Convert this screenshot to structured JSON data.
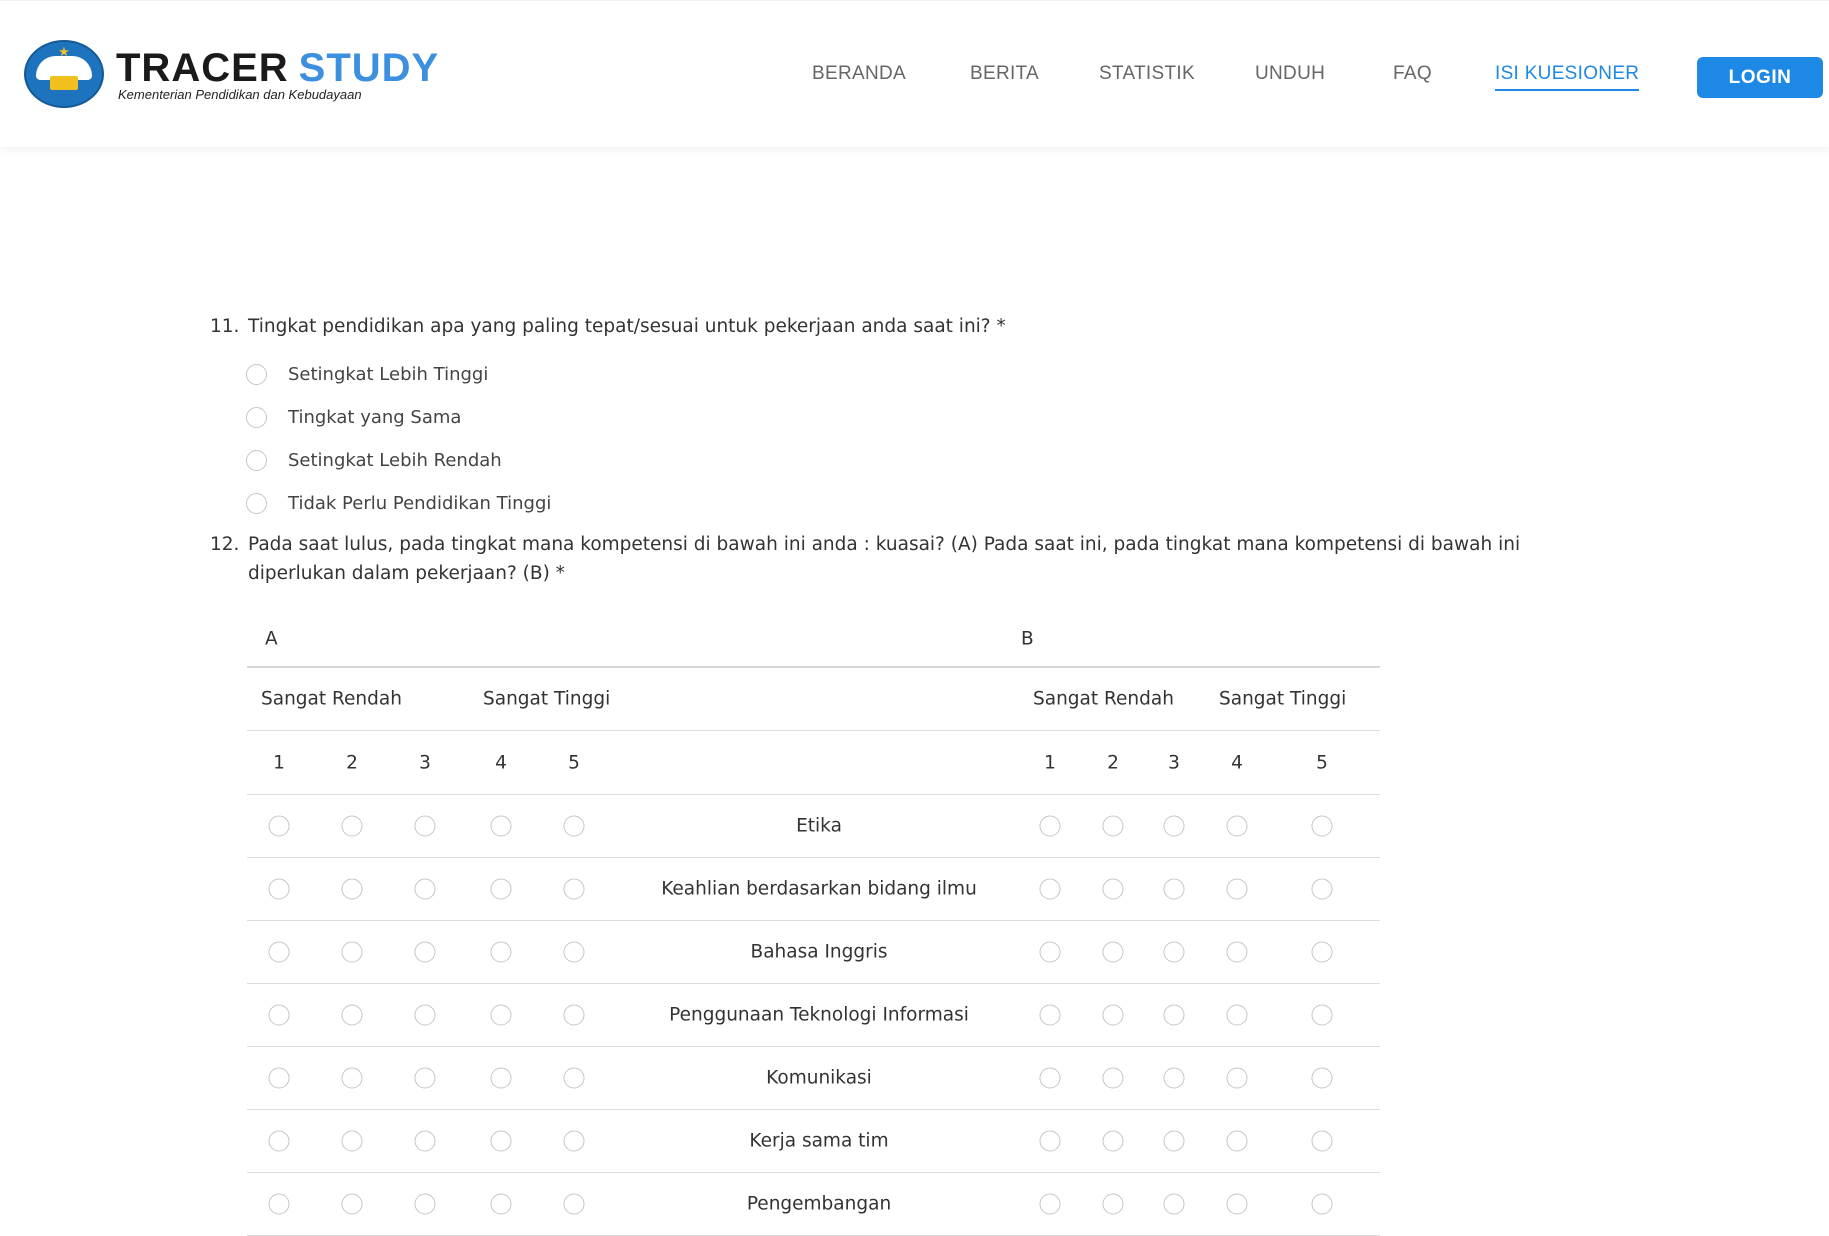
{
  "header": {
    "logo": {
      "title_part1": "TRACER",
      "title_part2": "STUDY",
      "subtitle": "Kementerian Pendidikan dan Kebudayaan"
    },
    "nav": [
      {
        "label": "BERANDA",
        "active": false
      },
      {
        "label": "BERITA",
        "active": false
      },
      {
        "label": "STATISTIK",
        "active": false
      },
      {
        "label": "UNDUH",
        "active": false
      },
      {
        "label": "FAQ",
        "active": false
      },
      {
        "label": "ISI KUESIONER",
        "active": true
      }
    ],
    "login_label": "LOGIN",
    "colors": {
      "accent": "#1e88e5",
      "brand_blue": "#3d8fdf",
      "nav_text": "#666666"
    }
  },
  "q11": {
    "number": "11.",
    "text": "Tingkat pendidikan apa yang paling tepat/sesuai untuk pekerjaan anda saat ini? *",
    "options": [
      "Setingkat Lebih Tinggi",
      "Tingkat yang Sama",
      "Setingkat Lebih Rendah",
      "Tidak Perlu Pendidikan Tinggi"
    ]
  },
  "q12": {
    "number": "12.",
    "text": "Pada saat lulus, pada tingkat mana kompetensi di bawah ini anda : kuasai? (A) Pada saat ini, pada tingkat mana kompetensi di bawah ini diperlukan dalam pekerjaan? (B) *",
    "matrix": {
      "group_a": "A",
      "group_b": "B",
      "scale_low": "Sangat Rendah",
      "scale_high": "Sangat Tinggi",
      "scale_values": [
        "1",
        "2",
        "3",
        "4",
        "5"
      ],
      "items": [
        "Etika",
        "Keahlian berdasarkan bidang ilmu",
        "Bahasa Inggris",
        "Penggunaan Teknologi Informasi",
        "Komunikasi",
        "Kerja sama tim",
        "Pengembangan"
      ]
    }
  }
}
